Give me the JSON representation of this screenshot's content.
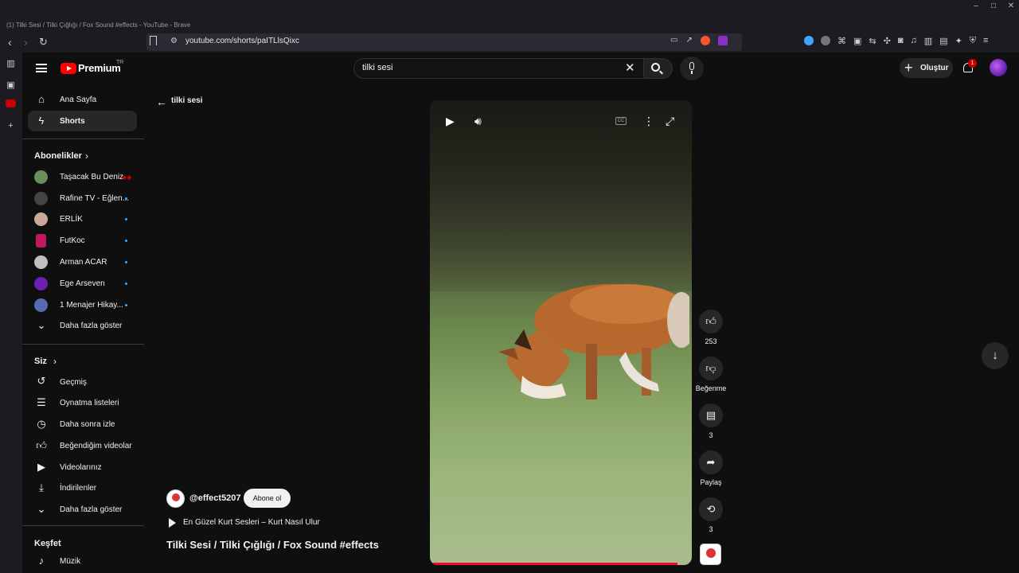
{
  "browser": {
    "window_title": "(1) Tilki Sesi / Tilki Çığlığı / Fox Sound #effects - YouTube - Brave",
    "url": "youtube.com/shorts/paITLlsQixc"
  },
  "header": {
    "brand": "Premium",
    "region": "TR",
    "search_value": "tilki sesi",
    "create_label": "Oluştur",
    "notification_count": "1"
  },
  "sidebar": {
    "main": [
      {
        "label": "Ana Sayfa",
        "icon": "home-icon"
      },
      {
        "label": "Shorts",
        "icon": "shorts-icon",
        "active": true
      }
    ],
    "subscriptions_title": "Abonelikler",
    "subscriptions": [
      {
        "label": "Taşacak Bu Deniz",
        "color": "#6a8f5a",
        "live": true
      },
      {
        "label": "Rafine TV - Eğlen...",
        "color": "#444444"
      },
      {
        "label": "ERLİK",
        "color": "#c9a89a"
      },
      {
        "label": "FutKoc",
        "color": "#c2185b"
      },
      {
        "label": "Arman ACAR",
        "color": "#bfbfbf"
      },
      {
        "label": "Ege Arseven",
        "color": "#6a1fb0"
      },
      {
        "label": "1 Menajer Hikay...",
        "color": "#5a6ab0"
      }
    ],
    "show_more_label": "Daha fazla göster",
    "you_title": "Siz",
    "you_items": [
      {
        "label": "Geçmiş",
        "icon": "history-icon"
      },
      {
        "label": "Oynatma listeleri",
        "icon": "playlist-icon"
      },
      {
        "label": "Daha sonra izle",
        "icon": "clock-icon"
      },
      {
        "label": "Beğendiğim videolar",
        "icon": "thumbs-up-icon"
      },
      {
        "label": "Videolarınız",
        "icon": "video-icon"
      },
      {
        "label": "İndirilenler",
        "icon": "download-icon"
      },
      {
        "label": "Daha fazla göster",
        "icon": "chevron-down-icon"
      }
    ],
    "explore_title": "Keşfet",
    "explore_items": [
      {
        "label": "Müzik",
        "icon": "music-icon"
      }
    ]
  },
  "main": {
    "back_label": "tilki sesi",
    "actions": {
      "like_count": "253",
      "dislike_label": "Beğenme",
      "comment_count": "3",
      "share_label": "Paylaş",
      "remix_count": "3"
    },
    "channel_handle": "@effect5207",
    "subscribe_label": "Abone ol",
    "related_title": "En Güzel Kurt Sesleri – Kurt Nasıl Ulur",
    "short_title": "Tilki Sesi / Tilki Çığlığı / Fox Sound  #effects",
    "progress": 0.97
  },
  "colors": {
    "accent": "#ff0000",
    "background": "#0f0f0f",
    "active_item": "#272727"
  }
}
